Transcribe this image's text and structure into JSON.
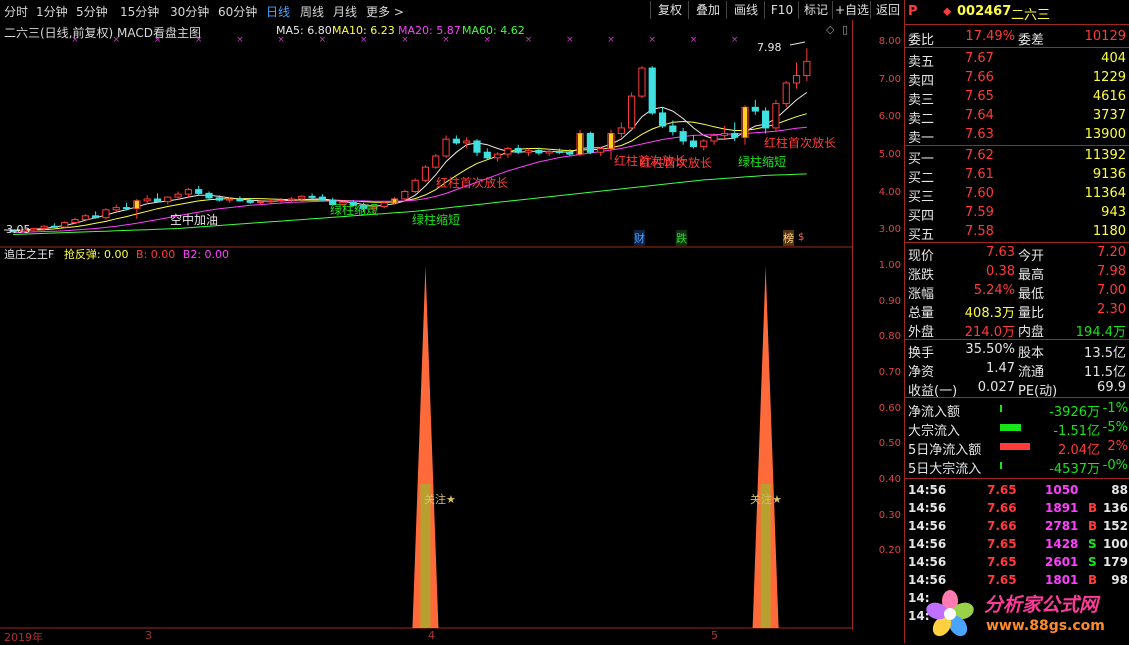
{
  "period_tabs": [
    "分时",
    "1分钟",
    "5分钟",
    "15分钟",
    "30分钟",
    "60分钟",
    "日线",
    "周线",
    "月线",
    "更多 >"
  ],
  "active_tab": "日线",
  "toolbar": [
    "复权",
    "叠加",
    "画线",
    "F10",
    "标记",
    "+自选",
    "返回"
  ],
  "main_title": "二六三(日线,前复权) MACD看盘主图",
  "ma": [
    {
      "label": "MA5: 6.80",
      "color": "#e8e8e8"
    },
    {
      "label": "MA10: 6.23",
      "color": "#ffff40"
    },
    {
      "label": "MA20: 5.87",
      "color": "#ff40ff"
    },
    {
      "label": "MA60: 4.62",
      "color": "#40ff40"
    }
  ],
  "price_axis": [
    "8.00",
    "7.00",
    "6.00",
    "5.00",
    "4.00",
    "3.00"
  ],
  "indicator_axis": [
    "1.00",
    "0.90",
    "0.80",
    "0.70",
    "0.60",
    "0.50",
    "0.40",
    "0.30",
    "0.20"
  ],
  "indicator_title": "追庄之王F",
  "indicator_values": [
    {
      "label": "抢反弹: 0.00",
      "color": "#ffff40"
    },
    {
      "label": "B: 0.00",
      "color": "#ff3b3b"
    },
    {
      "label": "B2: 0.00",
      "color": "#ff40ff"
    }
  ],
  "annotations": [
    {
      "text": "空中加油",
      "color": "#e8e8e8"
    },
    {
      "text": "绿柱缩短",
      "color": "#19e319"
    },
    {
      "text": "绿柱缩短",
      "color": "#19e319"
    },
    {
      "text": "红柱首次放长",
      "color": "#ff3b3b"
    },
    {
      "text": "红柱首次放长",
      "color": "#ff3b3b"
    },
    {
      "text": "红柱首次放长",
      "color": "#ff3b3b"
    },
    {
      "text": "绿柱缩短",
      "color": "#19e319"
    },
    {
      "text": "红柱首次放长",
      "color": "#ff3b3b"
    }
  ],
  "high_label": "7.98",
  "low_label": "3.05",
  "event_tags": [
    "财",
    "跌",
    "榜",
    "$"
  ],
  "signal_label": "关注★",
  "date_axis": [
    "2019年",
    "3",
    "4",
    "5"
  ],
  "chart_data": {
    "type": "candlestick",
    "ylim": [
      2.8,
      8.2
    ],
    "candles": [
      [
        3.1,
        3.12,
        3.05,
        3.08
      ],
      [
        3.08,
        3.15,
        3.05,
        3.12
      ],
      [
        3.12,
        3.18,
        3.08,
        3.16
      ],
      [
        3.16,
        3.25,
        3.12,
        3.22
      ],
      [
        3.22,
        3.3,
        3.18,
        3.2
      ],
      [
        3.2,
        3.35,
        3.18,
        3.32
      ],
      [
        3.32,
        3.45,
        3.28,
        3.4
      ],
      [
        3.4,
        3.55,
        3.35,
        3.5
      ],
      [
        3.5,
        3.62,
        3.42,
        3.45
      ],
      [
        3.45,
        3.7,
        3.4,
        3.66
      ],
      [
        3.66,
        3.8,
        3.6,
        3.72
      ],
      [
        3.72,
        3.85,
        3.65,
        3.7
      ],
      [
        3.7,
        3.95,
        3.42,
        3.9
      ],
      [
        3.9,
        4.05,
        3.82,
        3.95
      ],
      [
        3.95,
        4.1,
        3.85,
        3.88
      ],
      [
        3.88,
        4.02,
        3.8,
        4.0
      ],
      [
        4.0,
        4.15,
        3.92,
        4.08
      ],
      [
        4.08,
        4.25,
        4.0,
        4.2
      ],
      [
        4.2,
        4.3,
        4.05,
        4.1
      ],
      [
        4.1,
        4.15,
        3.95,
        3.98
      ],
      [
        3.98,
        4.05,
        3.88,
        3.92
      ],
      [
        3.92,
        4.0,
        3.85,
        3.95
      ],
      [
        3.95,
        4.02,
        3.88,
        3.9
      ],
      [
        3.9,
        3.98,
        3.82,
        3.86
      ],
      [
        3.86,
        3.92,
        3.8,
        3.88
      ],
      [
        3.88,
        3.95,
        3.82,
        3.9
      ],
      [
        3.9,
        3.98,
        3.84,
        3.92
      ],
      [
        3.92,
        4.0,
        3.86,
        3.95
      ],
      [
        3.95,
        4.05,
        3.88,
        4.02
      ],
      [
        4.02,
        4.1,
        3.95,
        4.0
      ],
      [
        4.0,
        4.08,
        3.9,
        3.92
      ],
      [
        3.92,
        3.98,
        3.78,
        3.8
      ],
      [
        3.8,
        3.9,
        3.72,
        3.86
      ],
      [
        3.86,
        3.92,
        3.75,
        3.78
      ],
      [
        3.78,
        3.85,
        3.62,
        3.7
      ],
      [
        3.7,
        3.8,
        3.55,
        3.75
      ],
      [
        3.75,
        3.9,
        3.7,
        3.85
      ],
      [
        3.85,
        4.0,
        3.8,
        3.95
      ],
      [
        3.95,
        4.2,
        3.9,
        4.15
      ],
      [
        4.15,
        4.5,
        4.1,
        4.45
      ],
      [
        4.45,
        4.85,
        4.4,
        4.8
      ],
      [
        4.8,
        5.15,
        4.75,
        5.1
      ],
      [
        5.1,
        5.65,
        5.05,
        5.55
      ],
      [
        5.55,
        5.65,
        5.4,
        5.45
      ],
      [
        5.45,
        5.6,
        5.3,
        5.5
      ],
      [
        5.5,
        5.55,
        5.1,
        5.2
      ],
      [
        5.2,
        5.3,
        5.0,
        5.05
      ],
      [
        5.05,
        5.2,
        4.95,
        5.15
      ],
      [
        5.15,
        5.35,
        5.05,
        5.3
      ],
      [
        5.3,
        5.4,
        5.15,
        5.2
      ],
      [
        5.2,
        5.3,
        5.1,
        5.25
      ],
      [
        5.25,
        5.32,
        5.12,
        5.18
      ],
      [
        5.18,
        5.28,
        5.1,
        5.22
      ],
      [
        5.22,
        5.3,
        5.15,
        5.2
      ],
      [
        5.2,
        5.28,
        5.1,
        5.15
      ],
      [
        5.15,
        5.8,
        5.1,
        5.7
      ],
      [
        5.7,
        5.75,
        5.15,
        5.2
      ],
      [
        5.2,
        5.35,
        5.1,
        5.3
      ],
      [
        5.3,
        5.8,
        5.0,
        5.7
      ],
      [
        5.7,
        6.0,
        5.6,
        5.85
      ],
      [
        5.85,
        6.8,
        5.8,
        6.7
      ],
      [
        6.7,
        7.5,
        6.65,
        7.45
      ],
      [
        7.45,
        7.5,
        6.2,
        6.25
      ],
      [
        6.25,
        6.4,
        5.85,
        5.9
      ],
      [
        5.9,
        6.05,
        5.65,
        5.75
      ],
      [
        5.75,
        5.85,
        5.4,
        5.5
      ],
      [
        5.5,
        5.65,
        5.3,
        5.35
      ],
      [
        5.35,
        5.55,
        5.25,
        5.5
      ],
      [
        5.5,
        5.7,
        5.4,
        5.65
      ],
      [
        5.65,
        5.9,
        5.55,
        5.7
      ],
      [
        5.7,
        6.0,
        5.5,
        5.6
      ],
      [
        5.6,
        6.45,
        5.4,
        6.4
      ],
      [
        6.4,
        6.6,
        6.2,
        6.3
      ],
      [
        6.3,
        6.4,
        5.7,
        5.85
      ],
      [
        5.85,
        6.6,
        5.75,
        6.5
      ],
      [
        6.5,
        7.1,
        6.4,
        7.05
      ],
      [
        7.05,
        7.6,
        6.9,
        7.25
      ],
      [
        7.25,
        7.98,
        7.1,
        7.63
      ]
    ],
    "ma_lines": [
      {
        "name": "MA5",
        "color": "#e8e8e8",
        "values": [
          3.1,
          3.12,
          3.14,
          3.16,
          3.2,
          3.24,
          3.3,
          3.38,
          3.45,
          3.52,
          3.6,
          3.66,
          3.74,
          3.82,
          3.86,
          3.9,
          3.94,
          4.0,
          4.05,
          4.05,
          4.02,
          3.98,
          3.95,
          3.92,
          3.9,
          3.89,
          3.9,
          3.91,
          3.93,
          3.95,
          3.95,
          3.92,
          3.88,
          3.85,
          3.8,
          3.76,
          3.78,
          3.82,
          3.9,
          4.05,
          4.3,
          4.6,
          4.95,
          5.2,
          5.4,
          5.45,
          5.4,
          5.3,
          5.22,
          5.2,
          5.22,
          5.23,
          5.22,
          5.21,
          5.2,
          5.3,
          5.32,
          5.32,
          5.42,
          5.55,
          5.8,
          6.15,
          6.35,
          6.4,
          6.3,
          6.1,
          5.85,
          5.65,
          5.55,
          5.55,
          5.58,
          5.75,
          5.9,
          5.95,
          6.1,
          6.35,
          6.6,
          6.8
        ]
      },
      {
        "name": "MA10",
        "color": "#ffff40",
        "values": [
          3.1,
          3.11,
          3.12,
          3.13,
          3.15,
          3.18,
          3.21,
          3.25,
          3.3,
          3.35,
          3.42,
          3.48,
          3.55,
          3.62,
          3.69,
          3.75,
          3.8,
          3.85,
          3.9,
          3.93,
          3.95,
          3.96,
          3.96,
          3.96,
          3.96,
          3.95,
          3.94,
          3.93,
          3.92,
          3.92,
          3.92,
          3.92,
          3.91,
          3.9,
          3.88,
          3.86,
          3.86,
          3.87,
          3.9,
          3.96,
          4.06,
          4.2,
          4.4,
          4.58,
          4.75,
          4.9,
          5.0,
          5.1,
          5.2,
          5.28,
          5.3,
          5.3,
          5.28,
          5.26,
          5.24,
          5.26,
          5.27,
          5.28,
          5.32,
          5.38,
          5.5,
          5.68,
          5.82,
          5.92,
          6.0,
          6.02,
          6.0,
          5.95,
          5.88,
          5.82,
          5.78,
          5.78,
          5.82,
          5.88,
          5.95,
          6.05,
          6.15,
          6.23
        ]
      },
      {
        "name": "MA20",
        "color": "#ff40ff",
        "values": [
          3.05,
          3.06,
          3.07,
          3.08,
          3.09,
          3.1,
          3.12,
          3.14,
          3.16,
          3.19,
          3.22,
          3.26,
          3.3,
          3.35,
          3.4,
          3.45,
          3.5,
          3.55,
          3.6,
          3.65,
          3.69,
          3.72,
          3.75,
          3.78,
          3.8,
          3.82,
          3.84,
          3.86,
          3.87,
          3.88,
          3.89,
          3.9,
          3.9,
          3.9,
          3.9,
          3.89,
          3.89,
          3.89,
          3.9,
          3.92,
          3.96,
          4.02,
          4.1,
          4.2,
          4.3,
          4.4,
          4.5,
          4.6,
          4.7,
          4.78,
          4.86,
          4.94,
          5.0,
          5.06,
          5.1,
          5.14,
          5.18,
          5.22,
          5.26,
          5.3,
          5.36,
          5.42,
          5.48,
          5.54,
          5.58,
          5.62,
          5.65,
          5.66,
          5.67,
          5.68,
          5.69,
          5.7,
          5.72,
          5.74,
          5.76,
          5.8,
          5.84,
          5.87
        ]
      },
      {
        "name": "MA60",
        "color": "#40ff40",
        "values": [
          3.0,
          3.01,
          3.02,
          3.03,
          3.04,
          3.05,
          3.06,
          3.07,
          3.08,
          3.09,
          3.1,
          3.11,
          3.12,
          3.13,
          3.14,
          3.15,
          3.16,
          3.18,
          3.2,
          3.22,
          3.24,
          3.26,
          3.28,
          3.3,
          3.32,
          3.34,
          3.36,
          3.38,
          3.4,
          3.42,
          3.44,
          3.46,
          3.48,
          3.5,
          3.52,
          3.54,
          3.56,
          3.58,
          3.6,
          3.62,
          3.65,
          3.68,
          3.71,
          3.74,
          3.77,
          3.8,
          3.83,
          3.86,
          3.89,
          3.92,
          3.95,
          3.98,
          4.01,
          4.04,
          4.07,
          4.1,
          4.13,
          4.16,
          4.19,
          4.22,
          4.25,
          4.28,
          4.31,
          4.34,
          4.37,
          4.4,
          4.43,
          4.46,
          4.48,
          4.5,
          4.52,
          4.54,
          4.56,
          4.58,
          4.59,
          4.6,
          4.61,
          4.62
        ]
      }
    ],
    "indicator": {
      "type": "area",
      "ylim": [
        0.1,
        1.0
      ],
      "spikes_at_index": [
        40,
        73
      ],
      "peak": 1.0,
      "inner_level": 0.35
    }
  },
  "panel": {
    "logo": "P",
    "code": "002467",
    "name": "二六三",
    "webi": {
      "label1": "委比",
      "val1": "17.49%",
      "label2": "委差",
      "val2": "10129"
    },
    "asks": [
      {
        "label": "卖五",
        "price": "7.67",
        "vol": "404"
      },
      {
        "label": "卖四",
        "price": "7.66",
        "vol": "1229"
      },
      {
        "label": "卖三",
        "price": "7.65",
        "vol": "4616"
      },
      {
        "label": "卖二",
        "price": "7.64",
        "vol": "3737"
      },
      {
        "label": "卖一",
        "price": "7.63",
        "vol": "13900"
      }
    ],
    "bids": [
      {
        "label": "买一",
        "price": "7.62",
        "vol": "11392"
      },
      {
        "label": "买二",
        "price": "7.61",
        "vol": "9136"
      },
      {
        "label": "买三",
        "price": "7.60",
        "vol": "11364"
      },
      {
        "label": "买四",
        "price": "7.59",
        "vol": "943"
      },
      {
        "label": "买五",
        "price": "7.58",
        "vol": "1180"
      }
    ],
    "quote": [
      {
        "l1": "现价",
        "v1": "7.63",
        "c1": "r",
        "l2": "今开",
        "v2": "7.20",
        "c2": "r"
      },
      {
        "l1": "涨跌",
        "v1": "0.38",
        "c1": "r",
        "l2": "最高",
        "v2": "7.98",
        "c2": "r"
      },
      {
        "l1": "涨幅",
        "v1": "5.24%",
        "c1": "r",
        "l2": "最低",
        "v2": "7.00",
        "c2": "r"
      },
      {
        "l1": "总量",
        "v1": "408.3万",
        "c1": "y",
        "l2": "量比",
        "v2": "2.30",
        "c2": "r"
      },
      {
        "l1": "外盘",
        "v1": "214.0万",
        "c1": "r",
        "l2": "内盘",
        "v2": "194.4万",
        "c2": "g"
      }
    ],
    "fund": [
      {
        "l1": "换手",
        "v1": "35.50%",
        "l2": "股本",
        "v2": "13.5亿"
      },
      {
        "l1": "净资",
        "v1": "1.47",
        "l2": "流通",
        "v2": "11.5亿"
      },
      {
        "l1": "收益(一)",
        "v1": "0.027",
        "l2": "PE(动)",
        "v2": "69.9"
      }
    ],
    "flows": [
      {
        "label": "净流入额",
        "value": "-3926万",
        "pct": "-1%",
        "bar": 0.04,
        "color": "#19e319",
        "vcls": "g"
      },
      {
        "label": "大宗流入",
        "value": "-1.51亿",
        "pct": "-5%",
        "bar": 0.35,
        "color": "#19e319",
        "vcls": "g"
      },
      {
        "label": "5日净流入额",
        "value": "2.04亿",
        "pct": "2%",
        "bar": 0.5,
        "color": "#ff3b3b",
        "vcls": "r"
      },
      {
        "label": "5日大宗流入",
        "value": "-4537万",
        "pct": "-0%",
        "bar": 0.04,
        "color": "#19e319",
        "vcls": "g"
      }
    ],
    "ticks": [
      {
        "time": "14:56",
        "price": "7.65",
        "vol": "1050",
        "bs": "",
        "n": "88"
      },
      {
        "time": "14:56",
        "price": "7.66",
        "vol": "1891",
        "bs": "B",
        "n": "136"
      },
      {
        "time": "14:56",
        "price": "7.66",
        "vol": "2781",
        "bs": "B",
        "n": "152"
      },
      {
        "time": "14:56",
        "price": "7.65",
        "vol": "1428",
        "bs": "S",
        "n": "100"
      },
      {
        "time": "14:56",
        "price": "7.65",
        "vol": "2601",
        "bs": "S",
        "n": "179"
      },
      {
        "time": "14:56",
        "price": "7.65",
        "vol": "1801",
        "bs": "B",
        "n": "98"
      },
      {
        "time": "14:",
        "price": "",
        "vol": "",
        "bs": "",
        "n": ""
      },
      {
        "time": "14:",
        "price": "",
        "vol": "",
        "bs": "",
        "n": ""
      }
    ]
  },
  "watermark": {
    "title": "分析家公式网",
    "url": "www.88gs.com"
  }
}
